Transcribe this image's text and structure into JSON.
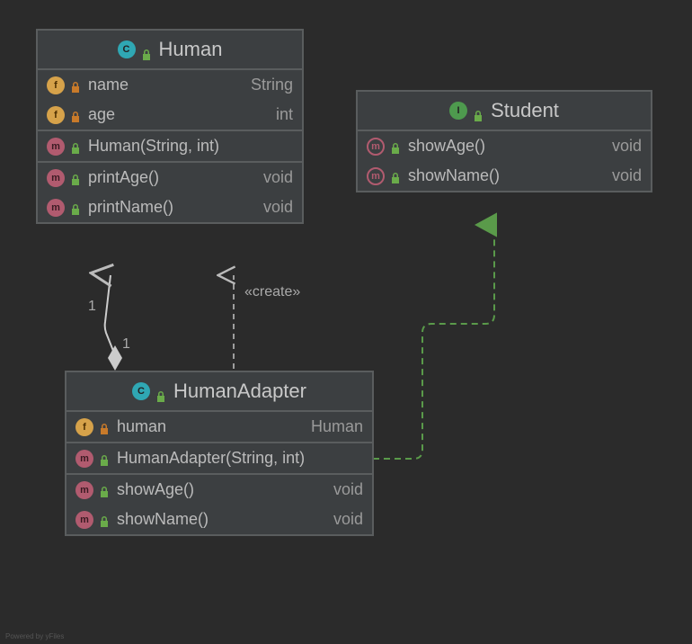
{
  "classes": {
    "human": {
      "kind": "class",
      "name": "Human",
      "fields": [
        {
          "name": "name",
          "type": "String",
          "visibility": "private"
        },
        {
          "name": "age",
          "type": "int",
          "visibility": "private"
        }
      ],
      "constructors": [
        {
          "signature": "Human(String, int)",
          "visibility": "public"
        }
      ],
      "methods": [
        {
          "signature": "printAge()",
          "returns": "void",
          "visibility": "public"
        },
        {
          "signature": "printName()",
          "returns": "void",
          "visibility": "public"
        }
      ]
    },
    "student": {
      "kind": "interface",
      "name": "Student",
      "methods": [
        {
          "signature": "showAge()",
          "returns": "void",
          "visibility": "public"
        },
        {
          "signature": "showName()",
          "returns": "void",
          "visibility": "public"
        }
      ]
    },
    "humanAdapter": {
      "kind": "class",
      "name": "HumanAdapter",
      "fields": [
        {
          "name": "human",
          "type": "Human",
          "visibility": "private"
        }
      ],
      "constructors": [
        {
          "signature": "HumanAdapter(String, int)",
          "visibility": "public"
        }
      ],
      "methods": [
        {
          "signature": "showAge()",
          "returns": "void",
          "visibility": "public"
        },
        {
          "signature": "showName()",
          "returns": "void",
          "visibility": "public"
        }
      ]
    }
  },
  "relationships": [
    {
      "from": "HumanAdapter",
      "to": "Student",
      "type": "realization",
      "style": "dashed-green-triangle"
    },
    {
      "from": "HumanAdapter",
      "to": "Human",
      "type": "dependency",
      "label": "«create»",
      "style": "dashed-open-arrow"
    },
    {
      "from": "HumanAdapter",
      "to": "Human",
      "type": "composition",
      "from_mult": "1",
      "to_mult": "1",
      "style": "solid-diamond"
    }
  ],
  "labels": {
    "create_stereo": "«create»",
    "mult_one_a": "1",
    "mult_one_b": "1",
    "credit": "Powered by yFiles"
  }
}
